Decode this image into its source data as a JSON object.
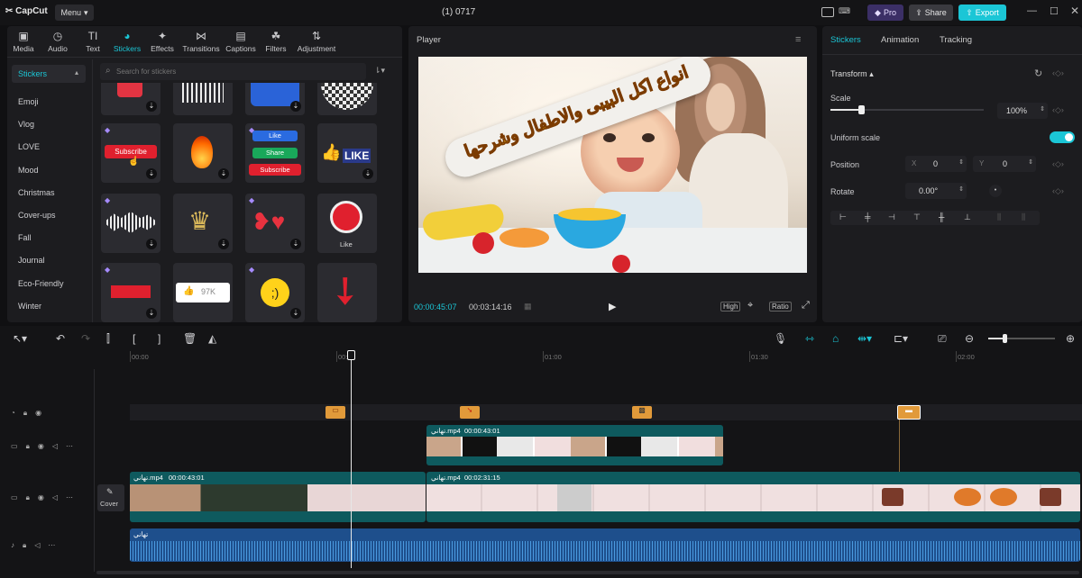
{
  "app": {
    "logo": "CapCut",
    "menu": "Menu",
    "title": "(1) 0717"
  },
  "topright": {
    "pro": "Pro",
    "share": "Share",
    "export": "Export"
  },
  "media_tabs": [
    {
      "label": "Media",
      "icon": "media-icon"
    },
    {
      "label": "Audio",
      "icon": "audio-icon"
    },
    {
      "label": "Text",
      "icon": "text-icon"
    },
    {
      "label": "Stickers",
      "icon": "stickers-icon",
      "active": true
    },
    {
      "label": "Effects",
      "icon": "effects-icon"
    },
    {
      "label": "Transitions",
      "icon": "transitions-icon"
    },
    {
      "label": "Captions",
      "icon": "captions-icon"
    },
    {
      "label": "Filters",
      "icon": "filters-icon"
    },
    {
      "label": "Adjustment",
      "icon": "adjustment-icon"
    }
  ],
  "sidebar": {
    "header": "Stickers",
    "items": [
      "Emoji",
      "Vlog",
      "LOVE",
      "Mood",
      "Christmas",
      "Cover-ups",
      "Fall",
      "Journal",
      "Eco-Friendly",
      "Winter"
    ]
  },
  "search": {
    "placeholder": "Search for stickers"
  },
  "stickers": {
    "subscribe": "Subscribe",
    "like": "Like",
    "share": "Share",
    "subscribe2": "Subscribe",
    "like_big": "LIKE",
    "like_caption": "Like",
    "count": "97K"
  },
  "player": {
    "title": "Player",
    "overlay_text": "انواع اكل البيبى والاطفال وشرحها",
    "current_time": "00:00:45:07",
    "total_time": "00:03:14:16",
    "quality": "High",
    "ratio": "Ratio"
  },
  "inspector": {
    "tabs": [
      "Stickers",
      "Animation",
      "Tracking"
    ],
    "transform": "Transform",
    "scale_label": "Scale",
    "scale_value": "100%",
    "scale_fraction": 0.2,
    "uniform_label": "Uniform scale",
    "uniform_on": true,
    "position_label": "Position",
    "pos_x_label": "X",
    "pos_x": "0",
    "pos_y_label": "Y",
    "pos_y": "0",
    "rotate_label": "Rotate",
    "rotate_value": "0.00°"
  },
  "timeline": {
    "ruler": [
      "00:00",
      "00:30",
      "01:00",
      "01:30",
      "02:00"
    ],
    "playhead_time_fraction": 0.232,
    "overlay_clip": {
      "name": "تهاني.mp4",
      "duration": "00:00:43:01"
    },
    "main_clip1": {
      "name": "تهاني.mp4",
      "duration": "00:00:43:01"
    },
    "main_clip2": {
      "name": "تهاني.mp4",
      "duration": "00:02:31:15"
    },
    "audio_clip": {
      "name": "تهاني"
    },
    "cover_label": "Cover"
  },
  "colors": {
    "accent": "#1bc6d6",
    "premium": "#a68bff",
    "clip_teal": "#0e5a5e",
    "audio_blue": "#1e4f8c",
    "sticker_orange": "#e19a3a"
  }
}
